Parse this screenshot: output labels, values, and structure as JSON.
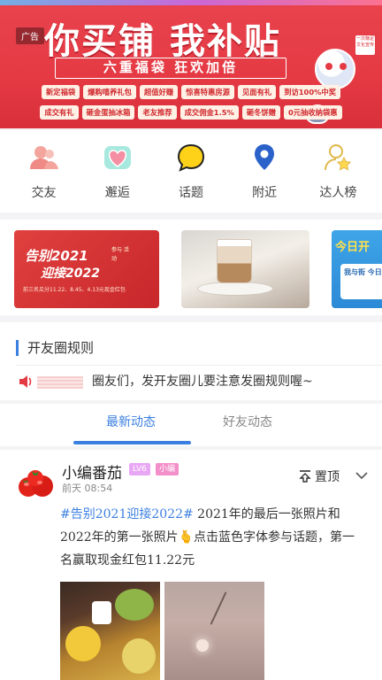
{
  "banner": {
    "ad_label": "广告",
    "title": "你买铺 我补贴",
    "subtitle": "六重福袋 狂欢加倍",
    "badge": "一次赚足文化宣传",
    "tags_row1": [
      "新定福袋",
      "爆购嘻养礼包",
      "超值好赚",
      "惊喜特惠房源",
      "见面有礼",
      "到访100%中奖"
    ],
    "tags_row2": [
      "成交有礼",
      "砸金蛋抽冰箱",
      "老友推荐",
      "成交佣金1.5%",
      "砸冬饼赠",
      "0元抽收纳袋惠"
    ]
  },
  "nav": [
    {
      "label": "交友",
      "icon": "friends-icon",
      "color": "#f08a84"
    },
    {
      "label": "邂逅",
      "icon": "heart-icon",
      "color": "#6fd2c6"
    },
    {
      "label": "话题",
      "icon": "chat-bubble-icon",
      "color": "#ffd21a"
    },
    {
      "label": "附近",
      "icon": "location-pin-icon",
      "color": "#2b62c9"
    },
    {
      "label": "达人榜",
      "icon": "star-person-icon",
      "color": "#e8c35a"
    }
  ],
  "promos": {
    "p1_line1": "告别2021",
    "p1_line2": "迎接2022",
    "p1_side": "参与 活动",
    "p1_footer": "前三名瓜分11.22、8.45、4.13元现金红包",
    "p3_title": "今日开",
    "p3_box": "我与街 今日开"
  },
  "rules": {
    "title": "开友圈规则",
    "marquee": "圈友们，发开友圈儿要注意发圈规则喔~"
  },
  "tabs": {
    "active": "最新动态",
    "inactive": "好友动态"
  },
  "post": {
    "username": "小编番茄",
    "level": "LV6",
    "rank": "小编",
    "time": "前天 08:54",
    "pin_label": "置顶",
    "hashtag": "#告别2021迎接2022#",
    "body": " 2021年的最后一张照片和2022年的第一张照片🫰点击蓝色字体参与话题，第一名赢取现金红包11.22元"
  },
  "colors": {
    "accent": "#3b7fe0",
    "banner_red": "#e53a44"
  }
}
